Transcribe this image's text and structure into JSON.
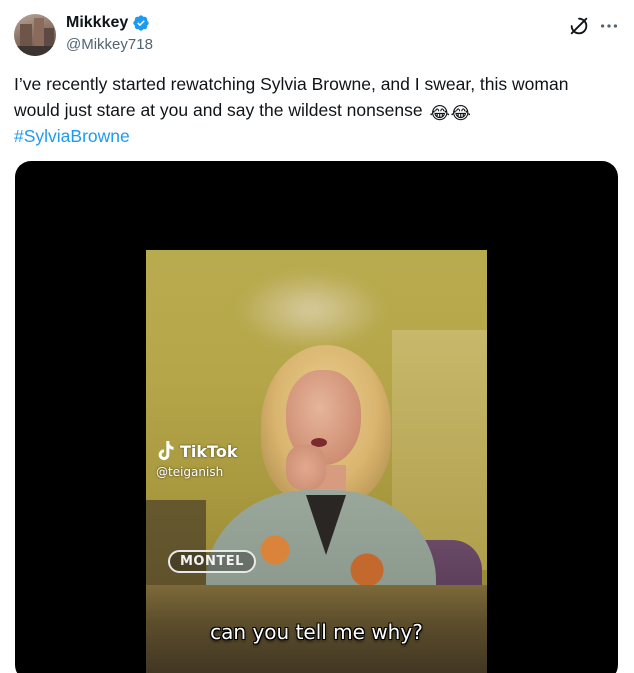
{
  "author": {
    "display_name": "Mikkkey",
    "handle": "@Mikkey718",
    "verified_icon": "verified-badge-icon"
  },
  "header_icons": {
    "grok": "grok-icon",
    "more": "more-icon"
  },
  "tweet": {
    "text": "I’ve recently started rewatching Sylvia Browne, and I swear, this woman would just stare at you and say the wildest nonsense",
    "emojis": [
      "😂",
      "😂"
    ],
    "hashtag": "#SylviaBrowne"
  },
  "media": {
    "watermark_brand": "TikTok",
    "watermark_user": "@teiganish",
    "show_logo": "MONTEL",
    "caption": "can you tell me why?"
  },
  "colors": {
    "link": "#1d9bf0",
    "secondary_text": "#536471",
    "verified": "#1d9bf0",
    "media_bg": "#000000"
  }
}
